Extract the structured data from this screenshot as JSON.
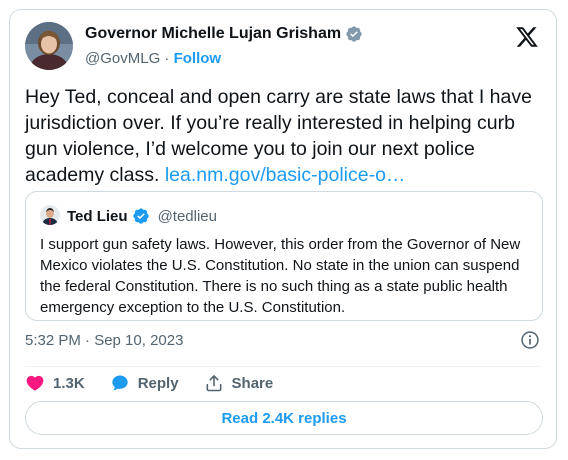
{
  "author": {
    "name": "Governor Michelle Lujan Grisham",
    "handle": "@GovMLG",
    "separator": "·",
    "follow_label": "Follow"
  },
  "tweet": {
    "text": "Hey Ted, conceal and open carry are state laws that I have jurisdiction over. If you’re really interested in helping curb gun violence, I’d welcome you to join our next police academy class.",
    "link_text": "lea.nm.gov/basic-police-o…",
    "timestamp": "5:32 PM · Sep 10, 2023"
  },
  "quoted": {
    "name": "Ted Lieu",
    "handle": "@tedlieu",
    "text": "I support gun safety laws. However, this order from the Governor of New Mexico violates the U.S. Constitution. No state in the union can suspend the federal Constitution. There is no such thing as a state public health emergency exception to the U.S. Constitution."
  },
  "actions": {
    "likes": "1.3K",
    "reply_label": "Reply",
    "share_label": "Share"
  },
  "replies_button": "Read 2.4K replies",
  "icons": {
    "verified": "verified-badge-icon",
    "platform": "x-logo-icon",
    "info": "info-icon",
    "like": "heart-icon",
    "reply": "speech-bubble-icon",
    "share": "share-arrow-icon"
  },
  "colors": {
    "accent": "#1d9bf0",
    "like": "#f91880",
    "text": "#0f1419",
    "muted": "#536471",
    "border": "#cfd9de"
  }
}
